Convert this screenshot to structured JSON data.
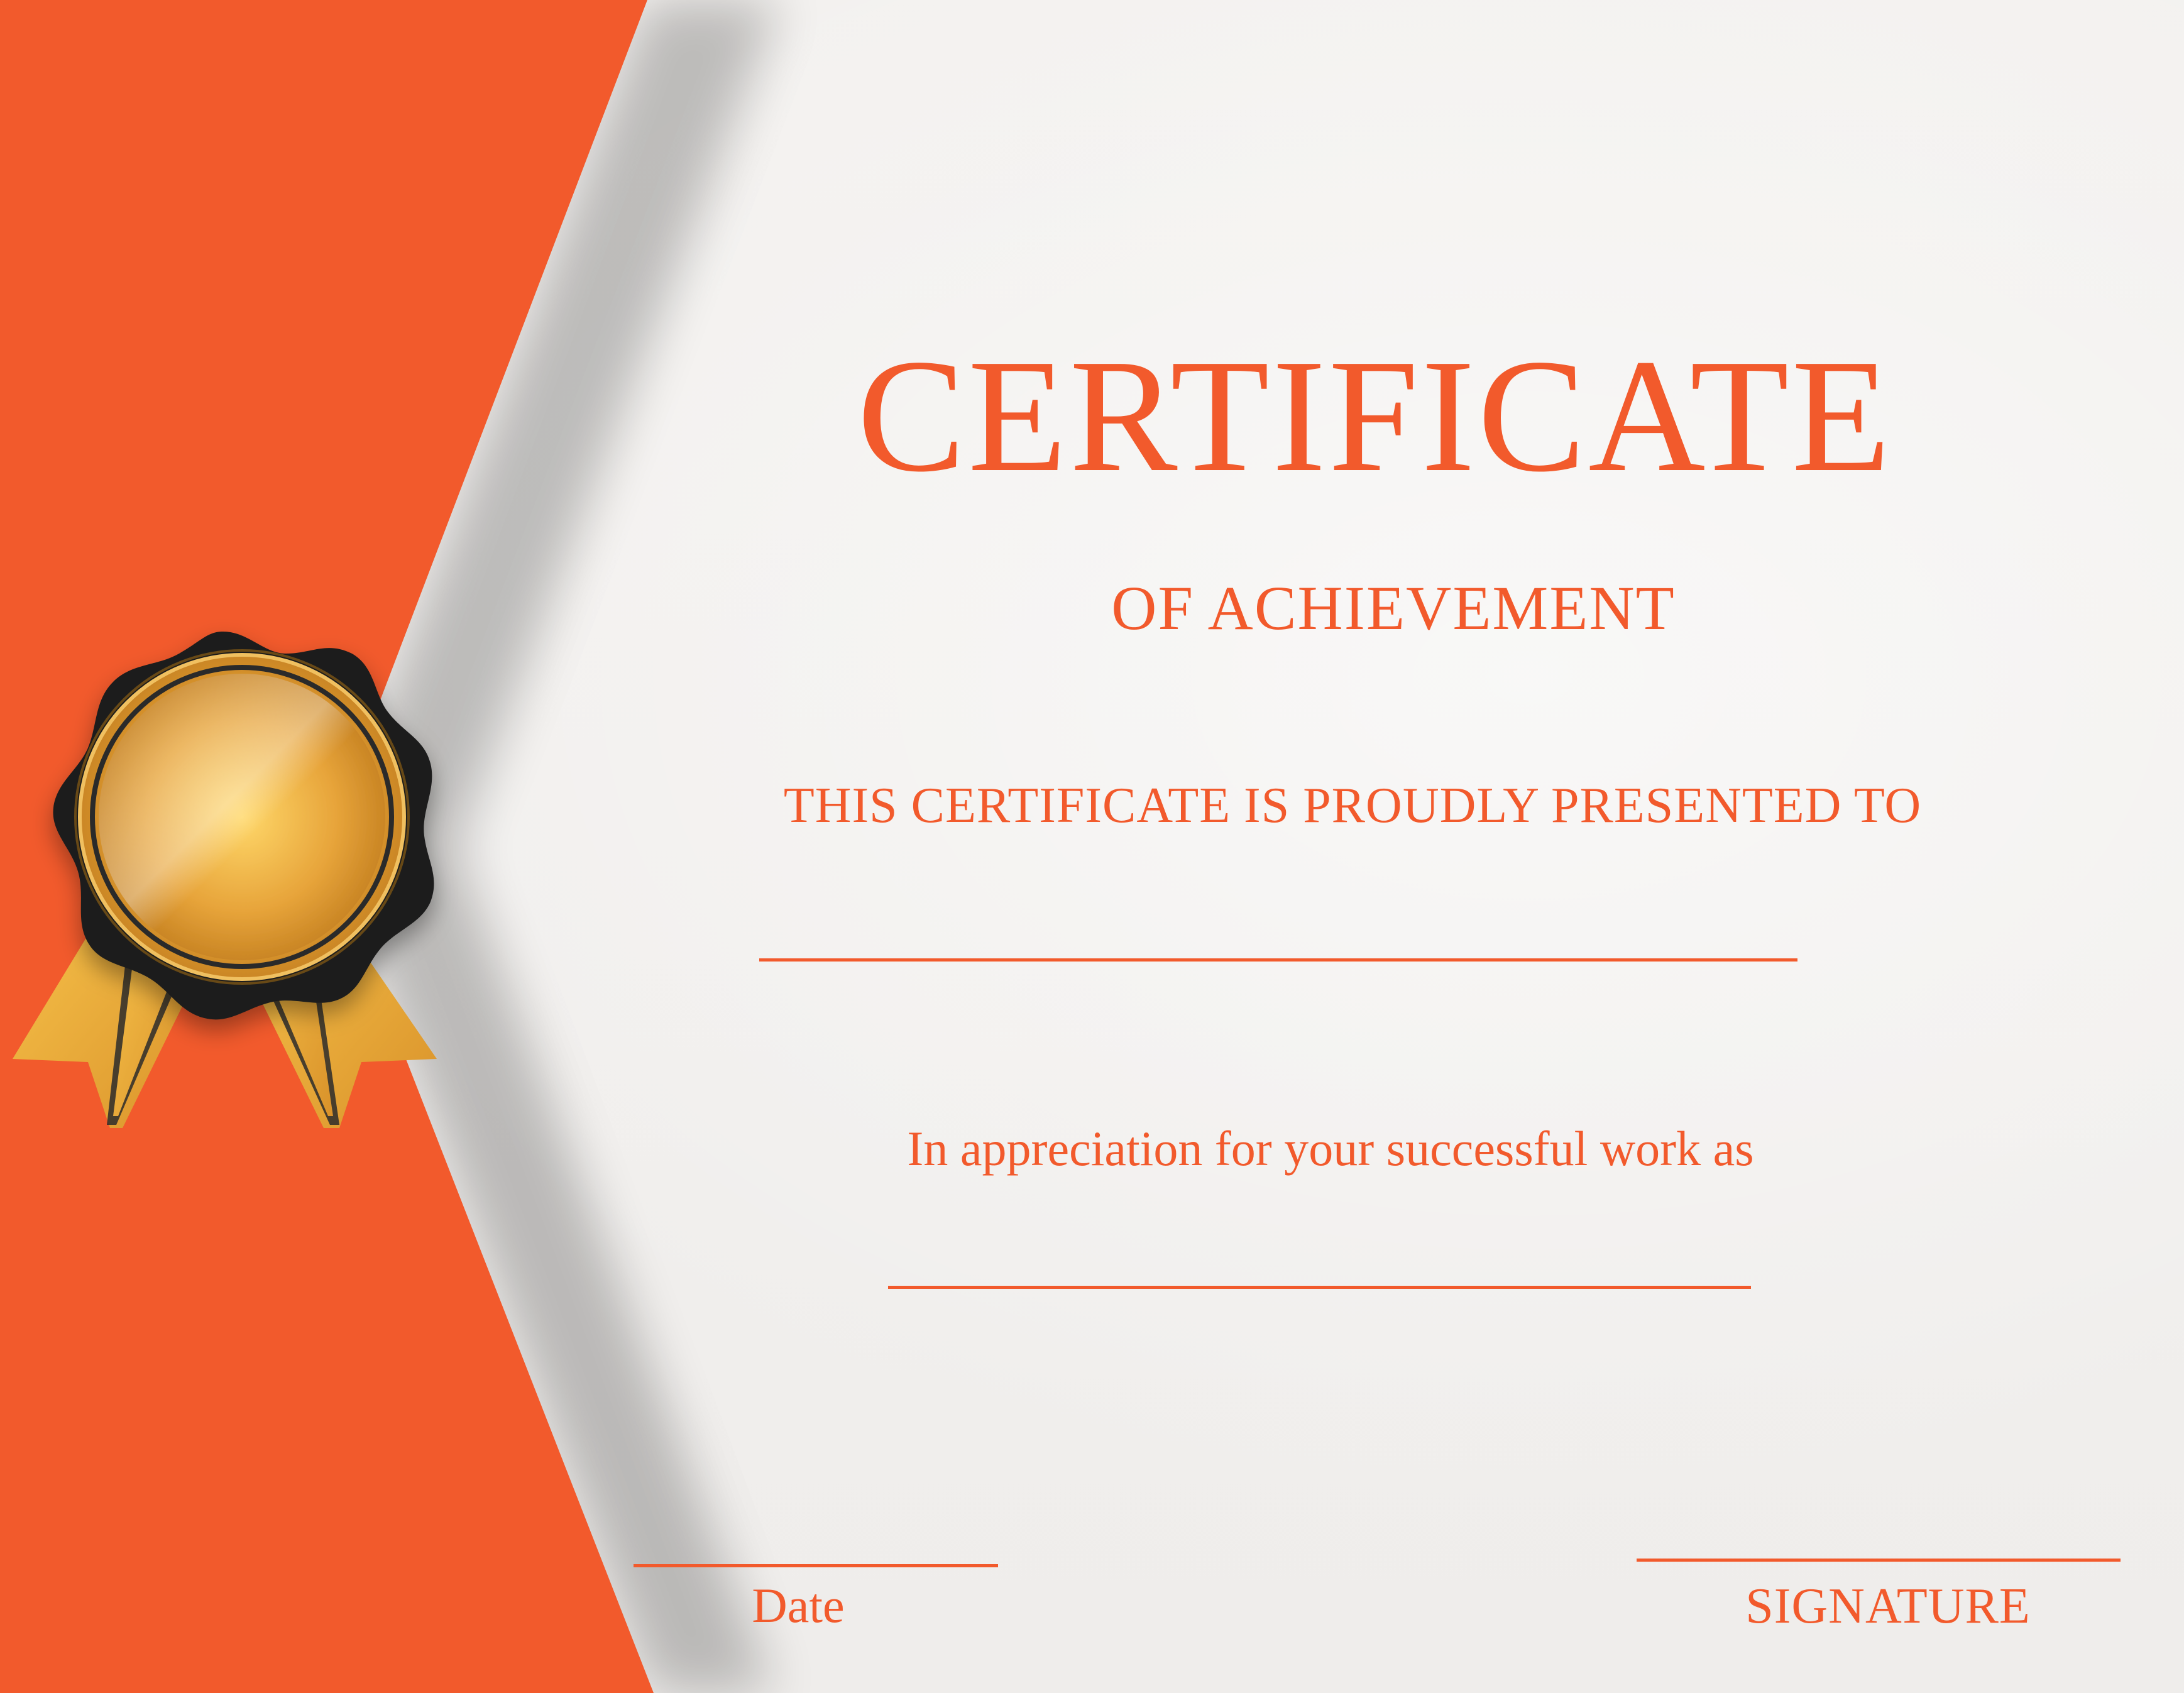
{
  "colors": {
    "accent": "#f25a2c",
    "paper": "#f1efed",
    "gold": "#e6a02e",
    "seal_dark": "#1f1f1f"
  },
  "certificate": {
    "title": "CERTIFICATE",
    "subtitle": "OF ACHIEVEMENT",
    "presented_line": "THIS CERTIFICATE IS PROUDLY PRESENTED TO",
    "appreciation_line": "In appreciation for your successful work as",
    "date_label": "Date",
    "signature_label": "SIGNATURE"
  },
  "decorations": {
    "seal_icon": "award-ribbon-seal-icon"
  }
}
